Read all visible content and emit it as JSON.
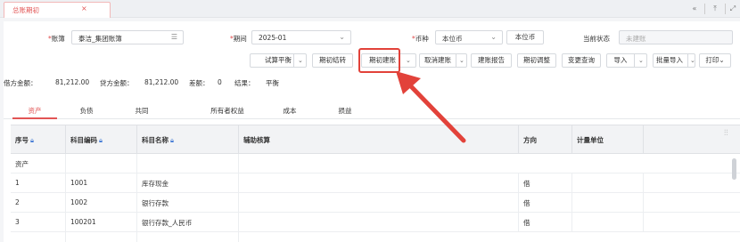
{
  "tab": {
    "title": "总账期初",
    "close": "×"
  },
  "window": {
    "btn1": "«",
    "btn2": "⤒",
    "btn3": "⤢"
  },
  "form": {
    "ledger_label": "账簿",
    "ledger_value": "泰洁_集团账簿",
    "period_label": "期间",
    "period_value": "2025-01",
    "currency_label": "币种",
    "currency_value": "本位币",
    "currency_button": "本位币",
    "status_label": "当前状态",
    "status_value": "未建账"
  },
  "toolbar": {
    "trial_balance": "试算平衡",
    "opening_settle": "期初结转",
    "opening_build": "期初建账",
    "cancel_build": "取消建账",
    "build_report": "建账报告",
    "opening_adjust": "期初调整",
    "change_query": "变更查询",
    "import": "导入",
    "batch_import": "批量导入",
    "print": "打印"
  },
  "summary": {
    "debit_label": "借方金额：",
    "debit_value": "81,212.00",
    "credit_label": "贷方金额：",
    "credit_value": "81,212.00",
    "diff_label": "差额：",
    "diff_value": "0",
    "result_label": "结果：",
    "result_value": "平衡"
  },
  "categories": [
    "资产",
    "负债",
    "共同",
    "所有者权益",
    "成本",
    "损益"
  ],
  "table": {
    "headers": [
      "序号",
      "科目编码",
      "科目名称",
      "辅助核算",
      "方向",
      "计量单位"
    ],
    "group": "资产",
    "rows": [
      {
        "seq": "1",
        "code": "1001",
        "name": "库存现金",
        "direction": "借"
      },
      {
        "seq": "2",
        "code": "1002",
        "name": "银行存款",
        "direction": "借"
      },
      {
        "seq": "3",
        "code": "100201",
        "name": "银行存款_人民币",
        "direction": "借"
      }
    ]
  }
}
